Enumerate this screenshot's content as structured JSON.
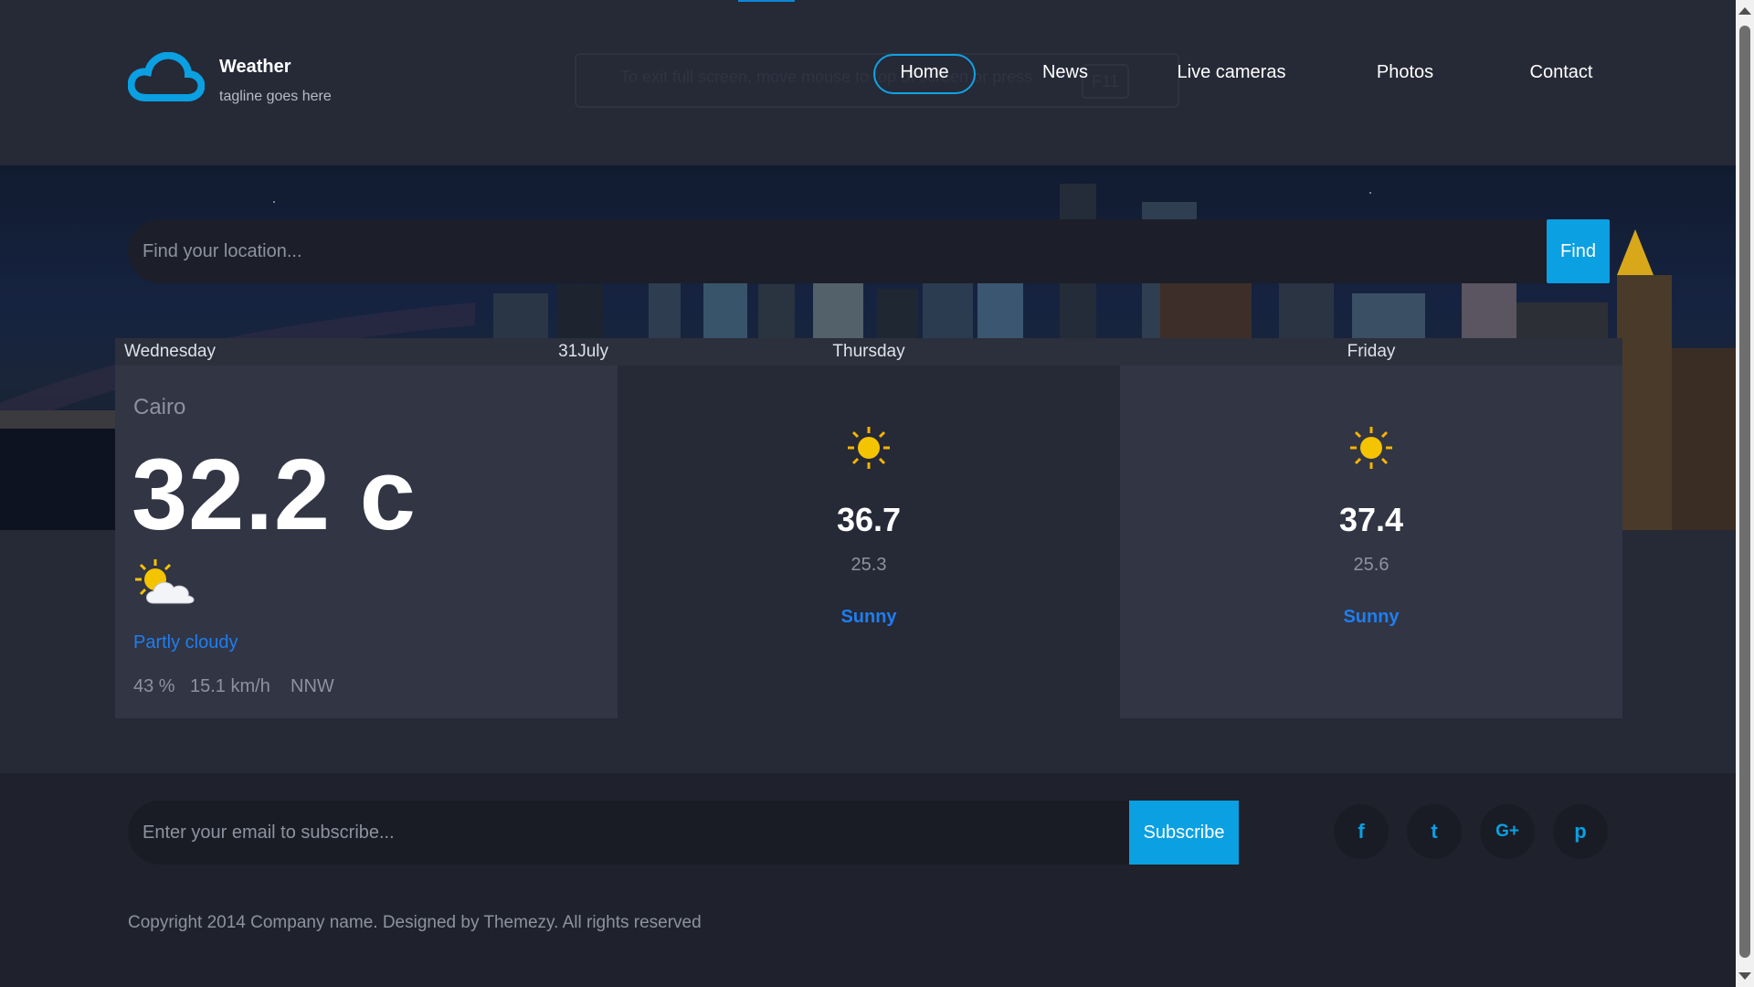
{
  "brand": {
    "title": "Weather",
    "tagline": "tagline goes here"
  },
  "overlay": {
    "text": "To exit full screen, move mouse to top of screen or press",
    "key": "F11"
  },
  "nav": {
    "items": [
      "Home",
      "News",
      "Live cameras",
      "Photos",
      "Contact"
    ],
    "active": "Home"
  },
  "search": {
    "placeholder": "Find your location...",
    "button": "Find"
  },
  "today": {
    "day": "Wednesday",
    "date": "31July",
    "location": "Cairo",
    "temperature": "32.2 c",
    "icon": "partly-cloudy-icon",
    "condition": "Partly cloudy",
    "humidity": "43 %",
    "wind_speed": "15.1 km/h",
    "wind_direction": "NNW"
  },
  "forecast": [
    {
      "day": "Thursday",
      "icon": "sun-icon",
      "high": "36.7",
      "low": "25.3",
      "condition": "Sunny"
    },
    {
      "day": "Friday",
      "icon": "sun-icon",
      "high": "37.4",
      "low": "25.6",
      "condition": "Sunny"
    }
  ],
  "subscribe": {
    "placeholder": "Enter your email to subscribe...",
    "button": "Subscribe"
  },
  "social": [
    {
      "name": "facebook-icon",
      "glyph": "f"
    },
    {
      "name": "twitter-icon",
      "glyph": "t"
    },
    {
      "name": "google-plus-icon",
      "glyph": "G+"
    },
    {
      "name": "pinterest-icon",
      "glyph": "p"
    }
  ],
  "footer": {
    "copyright": "Copyright 2014 Company name. Designed by Themezy. All rights reserved"
  },
  "colors": {
    "accent": "#0aa0e2",
    "condition_text": "#1e7ef0",
    "background": "#262936"
  }
}
